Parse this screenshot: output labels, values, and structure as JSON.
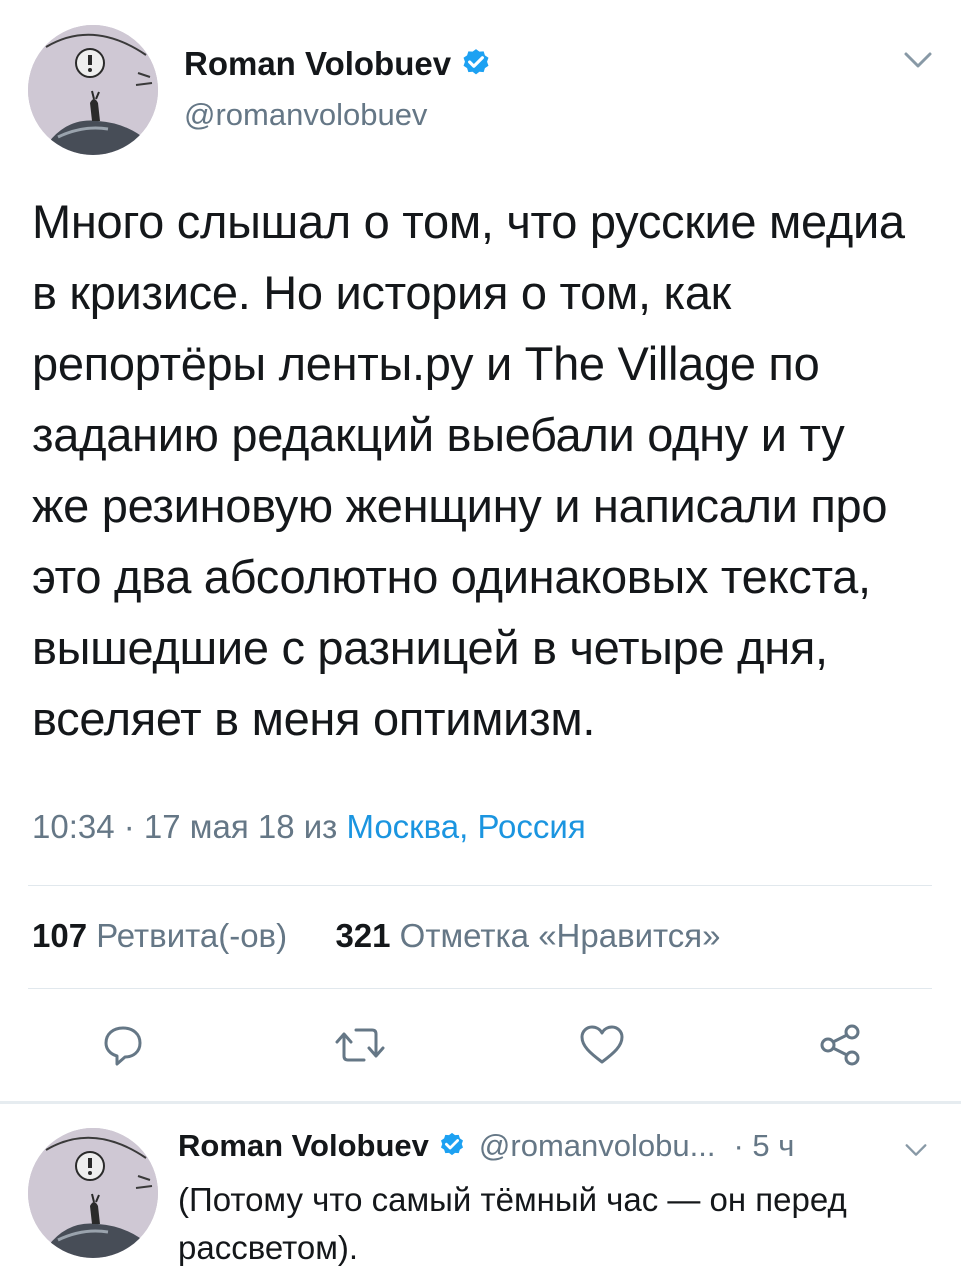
{
  "tweet": {
    "author_name": "Roman Volobuev",
    "author_handle": "@romanvolobuev",
    "text": "Много слышал о том, что русские медиа в кризисе. Но история о том, как репортёры ленты.ру и The Village по заданию редакций выебали одну и ту же резиновую женщину и написали про это два абсолютно одинаковых текста, вышедшие с разницей в четыре дня, вселяет в меня оптимизм.",
    "timestamp": "10:34 · 17 мая 18 из ",
    "location": "Москва, Россия",
    "retweets_count": "107",
    "retweets_label": "Ретвита(-ов)",
    "likes_count": "321",
    "likes_label": "Отметка «Нравится»"
  },
  "actions": {
    "reply_icon": "reply-icon",
    "retweet_icon": "retweet-icon",
    "like_icon": "heart-icon",
    "share_icon": "share-icon"
  },
  "reply": {
    "author_name": "Roman Volobuev",
    "author_handle": "@romanvolobu...",
    "time": "· 5 ч",
    "text": "(Потому что самый тёмный час — он перед рассветом)."
  },
  "colors": {
    "accent": "#1da1f2",
    "secondary_text": "#657786",
    "link": "#1b95e0"
  }
}
